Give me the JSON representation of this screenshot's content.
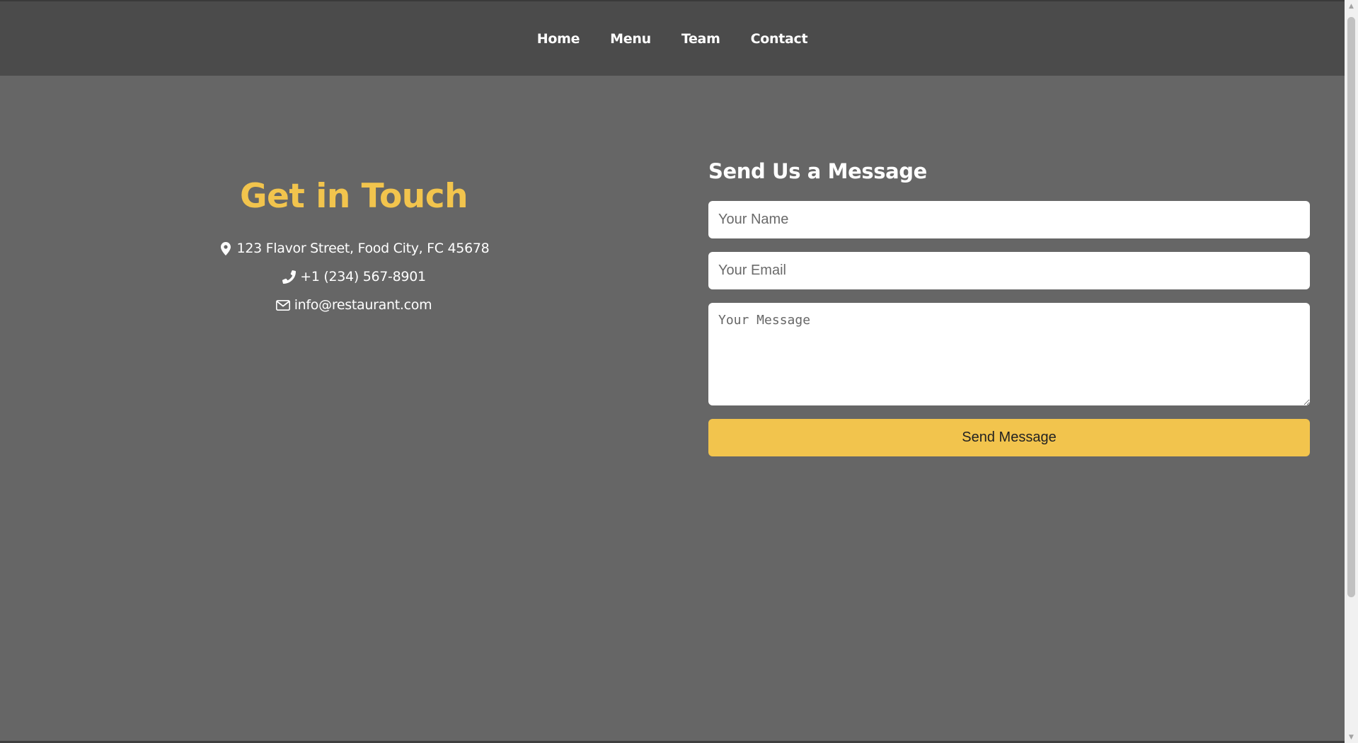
{
  "nav": {
    "items": [
      {
        "label": "Home"
      },
      {
        "label": "Menu"
      },
      {
        "label": "Team"
      },
      {
        "label": "Contact"
      }
    ]
  },
  "contact": {
    "title": "Get in Touch",
    "address": "123 Flavor Street, Food City, FC 45678",
    "phone": "+1 (234) 567-8901",
    "email": "info@restaurant.com",
    "icons": {
      "address": "map-marker-icon",
      "phone": "phone-icon",
      "email": "envelope-icon"
    }
  },
  "form": {
    "title": "Send Us a Message",
    "name_placeholder": "Your Name",
    "email_placeholder": "Your Email",
    "message_placeholder": "Your Message",
    "submit_label": "Send Message"
  },
  "colors": {
    "accent": "#f2c44d",
    "nav_bg": "#4b4b4b",
    "page_bg": "#666666",
    "text": "#ffffff"
  }
}
